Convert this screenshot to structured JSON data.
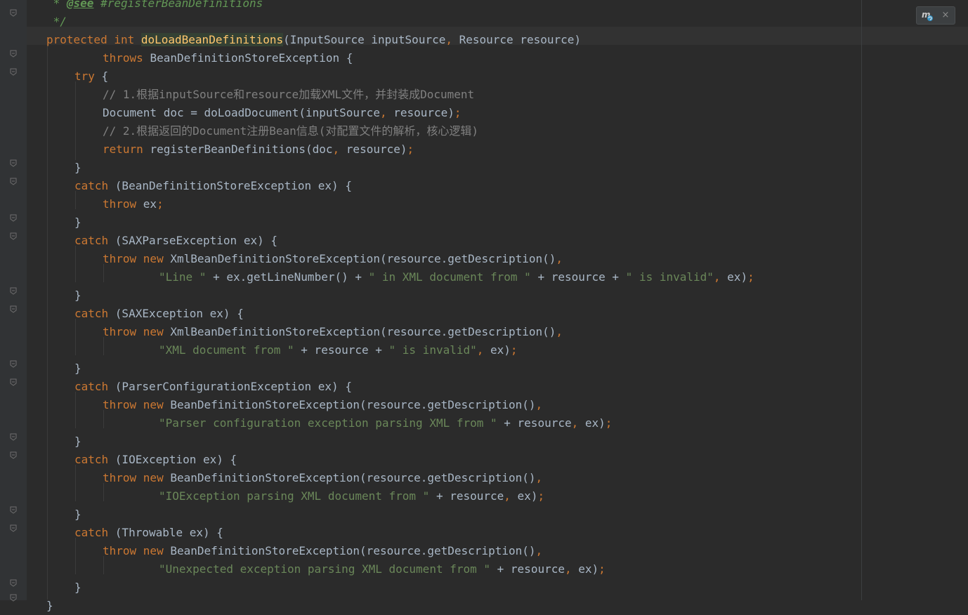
{
  "editor": {
    "language": "java",
    "widget": {
      "maven_icon": "maven-reload-icon",
      "close_glyph": "×"
    }
  },
  "lines": [
    {
      "segs": [
        [
          "doc",
          " * "
        ],
        [
          "doctag",
          "@see"
        ],
        [
          "doc",
          " #registerBeanDefinitions"
        ]
      ]
    },
    {
      "segs": [
        [
          "doc",
          " */"
        ]
      ]
    },
    {
      "segs": [
        [
          "kw",
          "protected int "
        ],
        [
          "hl-fn",
          "doLoadBeanDefinitions"
        ],
        [
          "",
          "(InputSource inputSource"
        ],
        [
          "pun",
          ", "
        ],
        [
          "",
          "Resource resource)"
        ]
      ]
    },
    {
      "segs": [
        [
          "kw",
          "throws "
        ],
        [
          "",
          "BeanDefinitionStoreException {"
        ]
      ]
    },
    {
      "segs": [
        [
          "kw",
          "try "
        ],
        [
          "",
          "{"
        ]
      ]
    },
    {
      "segs": [
        [
          "cm",
          "// 1.根据inputSource和resource加载XML文件，并封装成Document"
        ]
      ]
    },
    {
      "segs": [
        [
          "",
          "Document doc = doLoadDocument(inputSource"
        ],
        [
          "pun",
          ", "
        ],
        [
          "",
          "resource)"
        ],
        [
          "pun",
          ";"
        ]
      ]
    },
    {
      "segs": [
        [
          "cm",
          "// 2.根据返回的Document注册Bean信息(对配置文件的解析，核心逻辑)"
        ]
      ]
    },
    {
      "segs": [
        [
          "kw",
          "return "
        ],
        [
          "",
          "registerBeanDefinitions(doc"
        ],
        [
          "pun",
          ", "
        ],
        [
          "",
          "resource)"
        ],
        [
          "pun",
          ";"
        ]
      ]
    },
    {
      "segs": [
        [
          "",
          "}"
        ]
      ]
    },
    {
      "segs": [
        [
          "kw",
          "catch "
        ],
        [
          "",
          "(BeanDefinitionStoreException ex) {"
        ]
      ]
    },
    {
      "segs": [
        [
          "kw",
          "throw "
        ],
        [
          "",
          "ex"
        ],
        [
          "pun",
          ";"
        ]
      ]
    },
    {
      "segs": [
        [
          "",
          "}"
        ]
      ]
    },
    {
      "segs": [
        [
          "kw",
          "catch "
        ],
        [
          "",
          "(SAXParseException ex) {"
        ]
      ]
    },
    {
      "segs": [
        [
          "kw",
          "throw new "
        ],
        [
          "",
          "XmlBeanDefinitionStoreException(resource.getDescription()"
        ],
        [
          "pun",
          ","
        ]
      ]
    },
    {
      "segs": [
        [
          "str",
          "\"Line \""
        ],
        [
          "",
          " + ex.getLineNumber() + "
        ],
        [
          "str",
          "\" in XML document from \""
        ],
        [
          "",
          " + resource + "
        ],
        [
          "str",
          "\" is invalid\""
        ],
        [
          "pun",
          ", "
        ],
        [
          "",
          "ex)"
        ],
        [
          "pun",
          ";"
        ]
      ]
    },
    {
      "segs": [
        [
          "",
          "}"
        ]
      ]
    },
    {
      "segs": [
        [
          "kw",
          "catch "
        ],
        [
          "",
          "(SAXException ex) {"
        ]
      ]
    },
    {
      "segs": [
        [
          "kw",
          "throw new "
        ],
        [
          "",
          "XmlBeanDefinitionStoreException(resource.getDescription()"
        ],
        [
          "pun",
          ","
        ]
      ]
    },
    {
      "segs": [
        [
          "str",
          "\"XML document from \""
        ],
        [
          "",
          " + resource + "
        ],
        [
          "str",
          "\" is invalid\""
        ],
        [
          "pun",
          ", "
        ],
        [
          "",
          "ex)"
        ],
        [
          "pun",
          ";"
        ]
      ]
    },
    {
      "segs": [
        [
          "",
          "}"
        ]
      ]
    },
    {
      "segs": [
        [
          "kw",
          "catch "
        ],
        [
          "",
          "(ParserConfigurationException ex) {"
        ]
      ]
    },
    {
      "segs": [
        [
          "kw",
          "throw new "
        ],
        [
          "",
          "BeanDefinitionStoreException(resource.getDescription()"
        ],
        [
          "pun",
          ","
        ]
      ]
    },
    {
      "segs": [
        [
          "str",
          "\"Parser configuration exception parsing XML from \""
        ],
        [
          "",
          " + resource"
        ],
        [
          "pun",
          ", "
        ],
        [
          "",
          "ex)"
        ],
        [
          "pun",
          ";"
        ]
      ]
    },
    {
      "segs": [
        [
          "",
          "}"
        ]
      ]
    },
    {
      "segs": [
        [
          "kw",
          "catch "
        ],
        [
          "",
          "(IOException ex) {"
        ]
      ]
    },
    {
      "segs": [
        [
          "kw",
          "throw new "
        ],
        [
          "",
          "BeanDefinitionStoreException(resource.getDescription()"
        ],
        [
          "pun",
          ","
        ]
      ]
    },
    {
      "segs": [
        [
          "str",
          "\"IOException parsing XML document from \""
        ],
        [
          "",
          " + resource"
        ],
        [
          "pun",
          ", "
        ],
        [
          "",
          "ex)"
        ],
        [
          "pun",
          ";"
        ]
      ]
    },
    {
      "segs": [
        [
          "",
          "}"
        ]
      ]
    },
    {
      "segs": [
        [
          "kw",
          "catch "
        ],
        [
          "",
          "(Throwable ex) {"
        ]
      ]
    },
    {
      "segs": [
        [
          "kw",
          "throw new "
        ],
        [
          "",
          "BeanDefinitionStoreException(resource.getDescription()"
        ],
        [
          "pun",
          ","
        ]
      ]
    },
    {
      "segs": [
        [
          "str",
          "\"Unexpected exception parsing XML document from \""
        ],
        [
          "",
          " + resource"
        ],
        [
          "pun",
          ", "
        ],
        [
          "",
          "ex)"
        ],
        [
          "pun",
          ";"
        ]
      ]
    },
    {
      "segs": [
        [
          "",
          "}"
        ]
      ]
    },
    {
      "segs": [
        [
          "",
          "}"
        ]
      ]
    }
  ]
}
